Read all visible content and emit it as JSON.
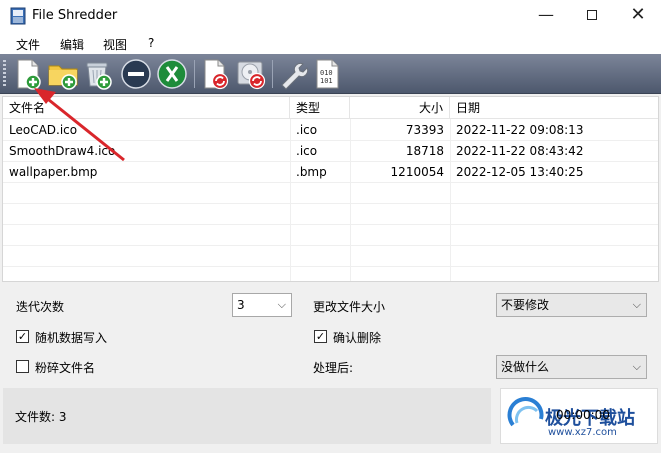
{
  "window": {
    "title": "File Shredder",
    "minimize": "—",
    "close": "✕"
  },
  "menu": [
    "文件",
    "编辑",
    "视图",
    "?"
  ],
  "toolbar": {
    "buttons": [
      "add-file",
      "add-folder",
      "add-recycle-bin",
      "remove",
      "clear",
      "shred-files",
      "shred-disk",
      "settings",
      "binary"
    ],
    "binary_text": "010\n101"
  },
  "list": {
    "columns": [
      "文件名",
      "类型",
      "大小",
      "日期"
    ],
    "rows": [
      {
        "name": "LeoCAD.ico",
        "type": ".ico",
        "size": "73393",
        "date": "2022-11-22 09:08:13"
      },
      {
        "name": "SmoothDraw4.ico",
        "type": ".ico",
        "size": "18718",
        "date": "2022-11-22 08:43:42"
      },
      {
        "name": "wallpaper.bmp",
        "type": ".bmp",
        "size": "1210054",
        "date": "2022-12-05 13:40:25"
      }
    ]
  },
  "options": {
    "iterations_label": "迭代次数",
    "iterations_value": "3",
    "change_size_label": "更改文件大小",
    "change_size_value": "不要修改",
    "random_data_label": "随机数据写入",
    "random_data_checked": true,
    "confirm_delete_label": "确认删除",
    "confirm_delete_checked": true,
    "shred_names_label": "粉碎文件名",
    "shred_names_checked": false,
    "after_label": "处理后:",
    "after_value": "没做什么"
  },
  "status": {
    "file_count": "文件数: 3",
    "timer": "00:00:00"
  },
  "watermark": {
    "text": "极光下载站",
    "url": "www.xz7.com"
  },
  "colors": {
    "accent_arrow": "#d9262b",
    "toolbar_top": "#7c8599",
    "toolbar_bottom": "#4d586d"
  }
}
